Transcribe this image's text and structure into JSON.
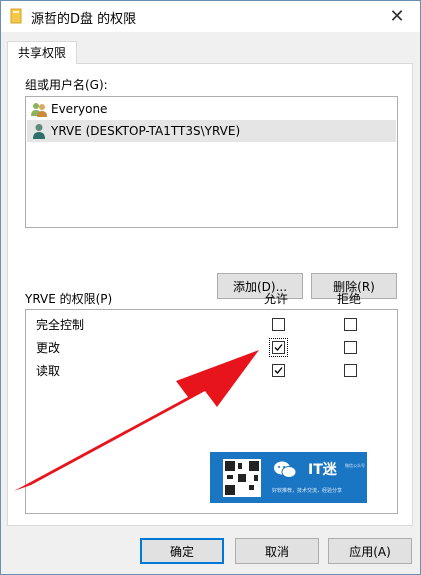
{
  "window": {
    "title": "源哲的D盘 的权限",
    "close_glyph": "✕"
  },
  "tab": {
    "label": "共享权限"
  },
  "group_label": "组或用户名(G):",
  "users": [
    {
      "name": "Everyone",
      "icon": "users-group-icon",
      "selected": false
    },
    {
      "name": "YRVE (DESKTOP-TA1TT3S\\YRVE)",
      "icon": "user-icon",
      "selected": true
    }
  ],
  "buttons": {
    "add": "添加(D)...",
    "remove": "删除(R)"
  },
  "permissions": {
    "header": "YRVE 的权限(P)",
    "allow_label": "允许",
    "deny_label": "拒绝",
    "rows": [
      {
        "name": "完全控制",
        "allow": false,
        "deny": false
      },
      {
        "name": "更改",
        "allow": true,
        "deny": false
      },
      {
        "name": "读取",
        "allow": true,
        "deny": false
      }
    ]
  },
  "footer": {
    "ok": "确定",
    "cancel": "取消",
    "apply": "应用(A)"
  },
  "watermark": {
    "brand": "IT迷",
    "small": "微信公众号",
    "tagline": "好软推荐，技术交流，经验分享"
  },
  "colors": {
    "accent": "#0078d7",
    "arrow": "#e8141b",
    "promo_bg": "#1a76c2"
  }
}
